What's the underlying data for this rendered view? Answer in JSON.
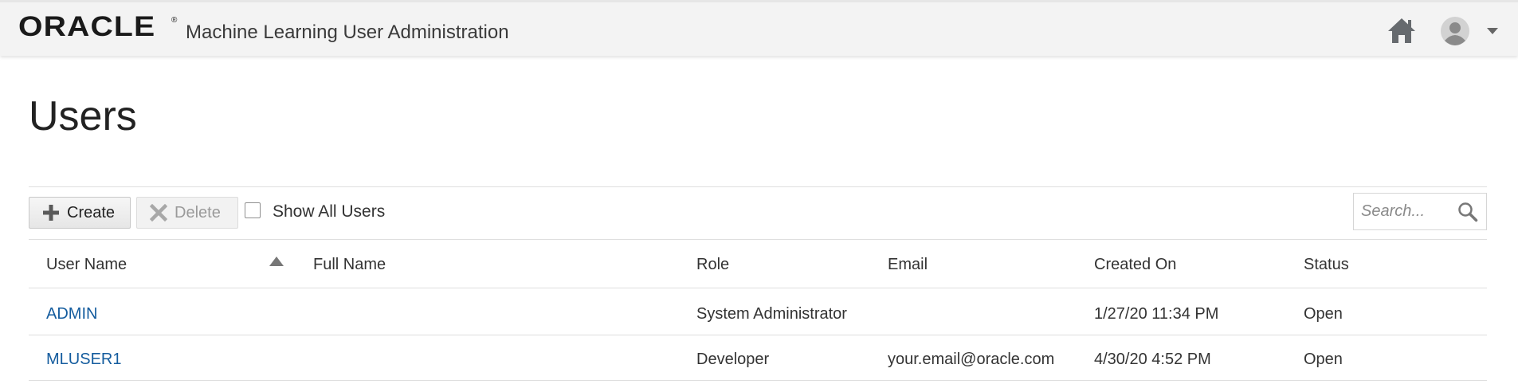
{
  "header": {
    "logo": "ORACLE",
    "logo_mark": "®",
    "app_title": "Machine Learning User Administration"
  },
  "page": {
    "title": "Users"
  },
  "toolbar": {
    "create_label": "Create",
    "delete_label": "Delete",
    "show_all_label": "Show All Users",
    "show_all_checked": false,
    "search_placeholder": "Search..."
  },
  "table": {
    "columns": [
      "User Name",
      "Full Name",
      "Role",
      "Email",
      "Created On",
      "Status"
    ],
    "sort": {
      "column": "User Name",
      "direction": "ascending"
    },
    "rows": [
      {
        "user_name": "ADMIN",
        "full_name": "",
        "role": "System Administrator",
        "email": "",
        "created_on": "1/27/20 11:34 PM",
        "status": "Open"
      },
      {
        "user_name": "MLUSER1",
        "full_name": "",
        "role": "Developer",
        "email": "your.email@oracle.com",
        "created_on": "4/30/20 4:52 PM",
        "status": "Open"
      }
    ]
  },
  "colors": {
    "link": "#145c9e",
    "header_bg": "#f3f3f3",
    "border": "#dedede"
  },
  "icons": {
    "home": "home-icon",
    "avatar": "user-avatar-icon",
    "caret": "caret-down-icon",
    "create": "plus-icon",
    "delete": "x-icon",
    "search": "search-icon",
    "sort": "sort-ascending-icon"
  }
}
